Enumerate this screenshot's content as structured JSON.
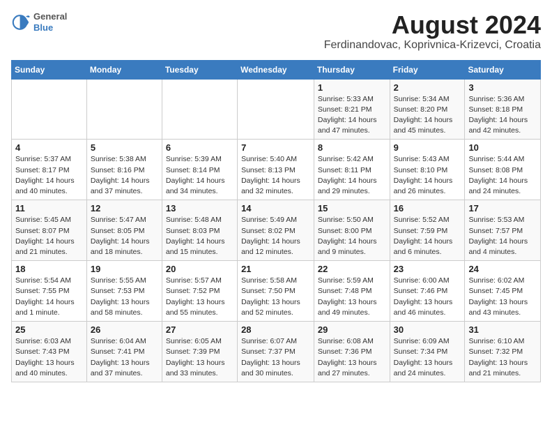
{
  "header": {
    "logo": {
      "general": "General",
      "blue": "Blue"
    },
    "title": "August 2024",
    "location": "Ferdinandovac, Koprivnica-Krizevci, Croatia"
  },
  "days_of_week": [
    "Sunday",
    "Monday",
    "Tuesday",
    "Wednesday",
    "Thursday",
    "Friday",
    "Saturday"
  ],
  "weeks": [
    [
      {
        "day": "",
        "info": ""
      },
      {
        "day": "",
        "info": ""
      },
      {
        "day": "",
        "info": ""
      },
      {
        "day": "",
        "info": ""
      },
      {
        "day": "1",
        "info": "Sunrise: 5:33 AM\nSunset: 8:21 PM\nDaylight: 14 hours and 47 minutes."
      },
      {
        "day": "2",
        "info": "Sunrise: 5:34 AM\nSunset: 8:20 PM\nDaylight: 14 hours and 45 minutes."
      },
      {
        "day": "3",
        "info": "Sunrise: 5:36 AM\nSunset: 8:18 PM\nDaylight: 14 hours and 42 minutes."
      }
    ],
    [
      {
        "day": "4",
        "info": "Sunrise: 5:37 AM\nSunset: 8:17 PM\nDaylight: 14 hours and 40 minutes."
      },
      {
        "day": "5",
        "info": "Sunrise: 5:38 AM\nSunset: 8:16 PM\nDaylight: 14 hours and 37 minutes."
      },
      {
        "day": "6",
        "info": "Sunrise: 5:39 AM\nSunset: 8:14 PM\nDaylight: 14 hours and 34 minutes."
      },
      {
        "day": "7",
        "info": "Sunrise: 5:40 AM\nSunset: 8:13 PM\nDaylight: 14 hours and 32 minutes."
      },
      {
        "day": "8",
        "info": "Sunrise: 5:42 AM\nSunset: 8:11 PM\nDaylight: 14 hours and 29 minutes."
      },
      {
        "day": "9",
        "info": "Sunrise: 5:43 AM\nSunset: 8:10 PM\nDaylight: 14 hours and 26 minutes."
      },
      {
        "day": "10",
        "info": "Sunrise: 5:44 AM\nSunset: 8:08 PM\nDaylight: 14 hours and 24 minutes."
      }
    ],
    [
      {
        "day": "11",
        "info": "Sunrise: 5:45 AM\nSunset: 8:07 PM\nDaylight: 14 hours and 21 minutes."
      },
      {
        "day": "12",
        "info": "Sunrise: 5:47 AM\nSunset: 8:05 PM\nDaylight: 14 hours and 18 minutes."
      },
      {
        "day": "13",
        "info": "Sunrise: 5:48 AM\nSunset: 8:03 PM\nDaylight: 14 hours and 15 minutes."
      },
      {
        "day": "14",
        "info": "Sunrise: 5:49 AM\nSunset: 8:02 PM\nDaylight: 14 hours and 12 minutes."
      },
      {
        "day": "15",
        "info": "Sunrise: 5:50 AM\nSunset: 8:00 PM\nDaylight: 14 hours and 9 minutes."
      },
      {
        "day": "16",
        "info": "Sunrise: 5:52 AM\nSunset: 7:59 PM\nDaylight: 14 hours and 6 minutes."
      },
      {
        "day": "17",
        "info": "Sunrise: 5:53 AM\nSunset: 7:57 PM\nDaylight: 14 hours and 4 minutes."
      }
    ],
    [
      {
        "day": "18",
        "info": "Sunrise: 5:54 AM\nSunset: 7:55 PM\nDaylight: 14 hours and 1 minute."
      },
      {
        "day": "19",
        "info": "Sunrise: 5:55 AM\nSunset: 7:53 PM\nDaylight: 13 hours and 58 minutes."
      },
      {
        "day": "20",
        "info": "Sunrise: 5:57 AM\nSunset: 7:52 PM\nDaylight: 13 hours and 55 minutes."
      },
      {
        "day": "21",
        "info": "Sunrise: 5:58 AM\nSunset: 7:50 PM\nDaylight: 13 hours and 52 minutes."
      },
      {
        "day": "22",
        "info": "Sunrise: 5:59 AM\nSunset: 7:48 PM\nDaylight: 13 hours and 49 minutes."
      },
      {
        "day": "23",
        "info": "Sunrise: 6:00 AM\nSunset: 7:46 PM\nDaylight: 13 hours and 46 minutes."
      },
      {
        "day": "24",
        "info": "Sunrise: 6:02 AM\nSunset: 7:45 PM\nDaylight: 13 hours and 43 minutes."
      }
    ],
    [
      {
        "day": "25",
        "info": "Sunrise: 6:03 AM\nSunset: 7:43 PM\nDaylight: 13 hours and 40 minutes."
      },
      {
        "day": "26",
        "info": "Sunrise: 6:04 AM\nSunset: 7:41 PM\nDaylight: 13 hours and 37 minutes."
      },
      {
        "day": "27",
        "info": "Sunrise: 6:05 AM\nSunset: 7:39 PM\nDaylight: 13 hours and 33 minutes."
      },
      {
        "day": "28",
        "info": "Sunrise: 6:07 AM\nSunset: 7:37 PM\nDaylight: 13 hours and 30 minutes."
      },
      {
        "day": "29",
        "info": "Sunrise: 6:08 AM\nSunset: 7:36 PM\nDaylight: 13 hours and 27 minutes."
      },
      {
        "day": "30",
        "info": "Sunrise: 6:09 AM\nSunset: 7:34 PM\nDaylight: 13 hours and 24 minutes."
      },
      {
        "day": "31",
        "info": "Sunrise: 6:10 AM\nSunset: 7:32 PM\nDaylight: 13 hours and 21 minutes."
      }
    ]
  ]
}
